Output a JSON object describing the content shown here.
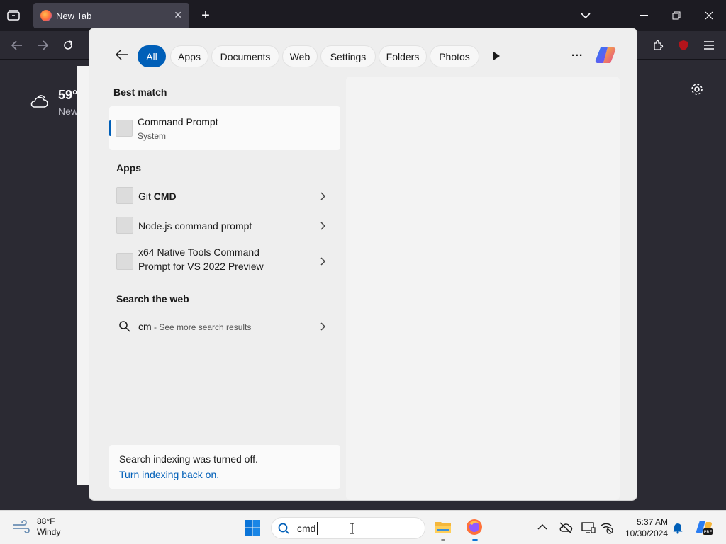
{
  "browser": {
    "tab_title": "New Tab",
    "weather_temp": "59°",
    "weather_place": "New"
  },
  "search": {
    "filters": [
      {
        "label": "All",
        "active": true
      },
      {
        "label": "Apps"
      },
      {
        "label": "Documents"
      },
      {
        "label": "Web"
      },
      {
        "label": "Settings"
      },
      {
        "label": "Folders"
      },
      {
        "label": "Photos"
      }
    ],
    "more_label": "...",
    "best_match_heading": "Best match",
    "best_match": {
      "title": "Command Prompt",
      "subtitle": "System"
    },
    "apps_heading": "Apps",
    "apps": [
      {
        "label_pre": "Git ",
        "label_bold": "CMD"
      },
      {
        "label": "Node.js command prompt"
      },
      {
        "line1": "x64 Native Tools Command",
        "line2": "Prompt for VS 2022 Preview"
      }
    ],
    "web_heading": "Search the web",
    "web_query": "cm",
    "web_hint": " - See more search results",
    "index_notice": "Search indexing was turned off.",
    "index_link": "Turn indexing back on."
  },
  "taskbar": {
    "weather_temp": "88°F",
    "weather_desc": "Windy",
    "search_value": "cmd",
    "time": "5:37 AM",
    "date": "10/30/2024"
  },
  "colors": {
    "accent": "#005fb8",
    "browser_bg": "#2b2a33",
    "panel_bg": "#eeeeee"
  }
}
